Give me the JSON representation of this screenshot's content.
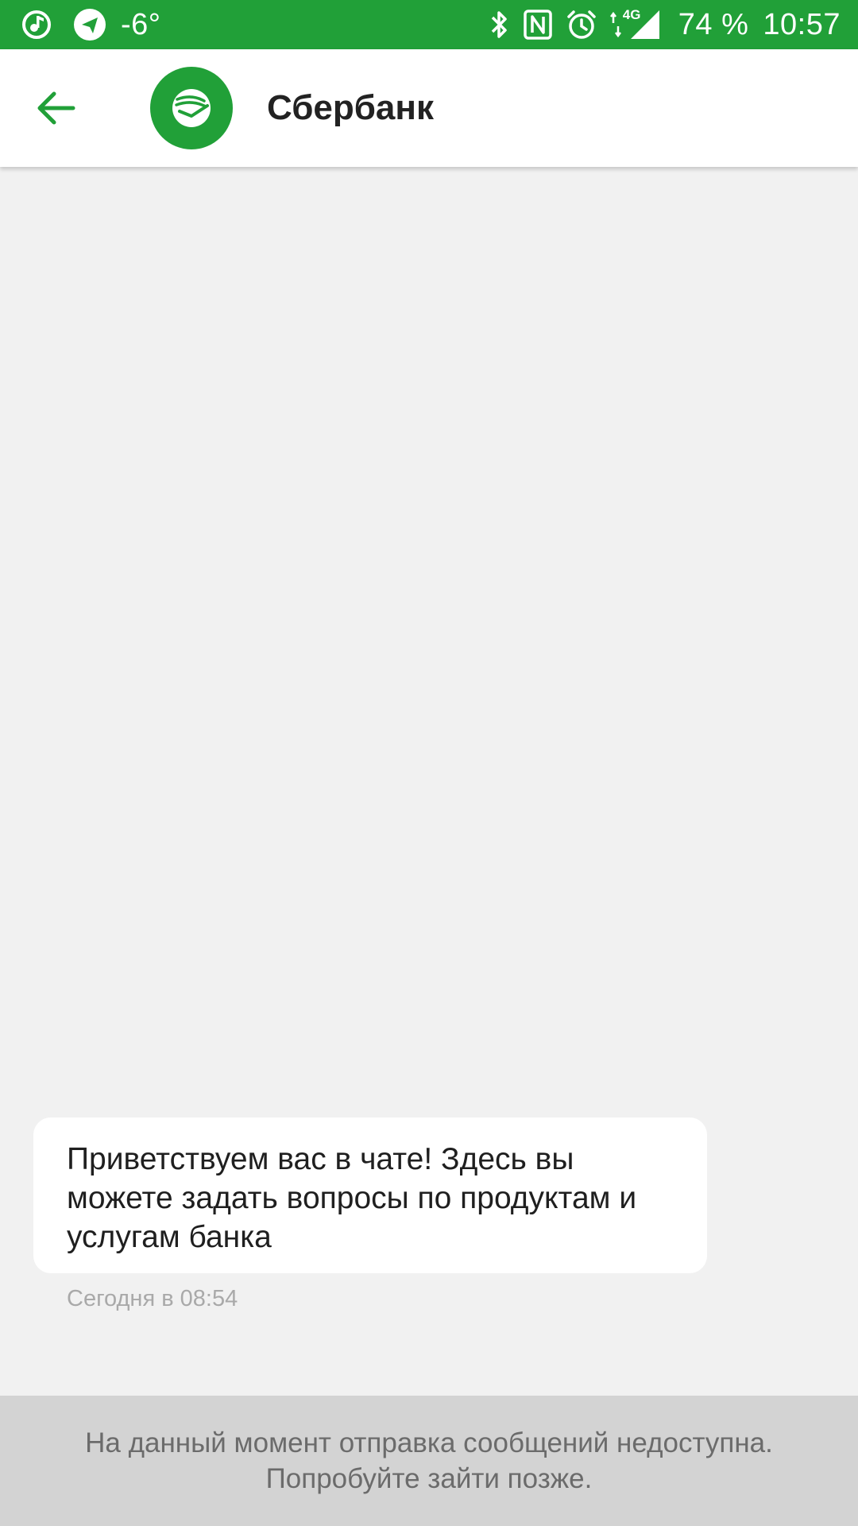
{
  "status_bar": {
    "temperature": "-6°",
    "network": "4G",
    "battery": "74 %",
    "time": "10:57",
    "icons": [
      "music-icon",
      "telegram-icon",
      "bluetooth-icon",
      "nfc-icon",
      "alarm-icon",
      "signal-icon"
    ]
  },
  "app_bar": {
    "title": "Сбербанк",
    "back_icon": "arrow-left-icon",
    "avatar_icon": "sberbank-logo-icon"
  },
  "messages": [
    {
      "text": "Приветствуем вас в чате! Здесь вы можете задать вопросы по продуктам и услугам банка",
      "time": "Сегодня в 08:54"
    }
  ],
  "notice": {
    "line1": "На данный момент отправка сообщений недоступна.",
    "line2": "Попробуйте зайти позже."
  },
  "colors": {
    "brand_green": "#21a038",
    "background": "#f1f1f1",
    "notice_bg": "#d3d3d3"
  }
}
